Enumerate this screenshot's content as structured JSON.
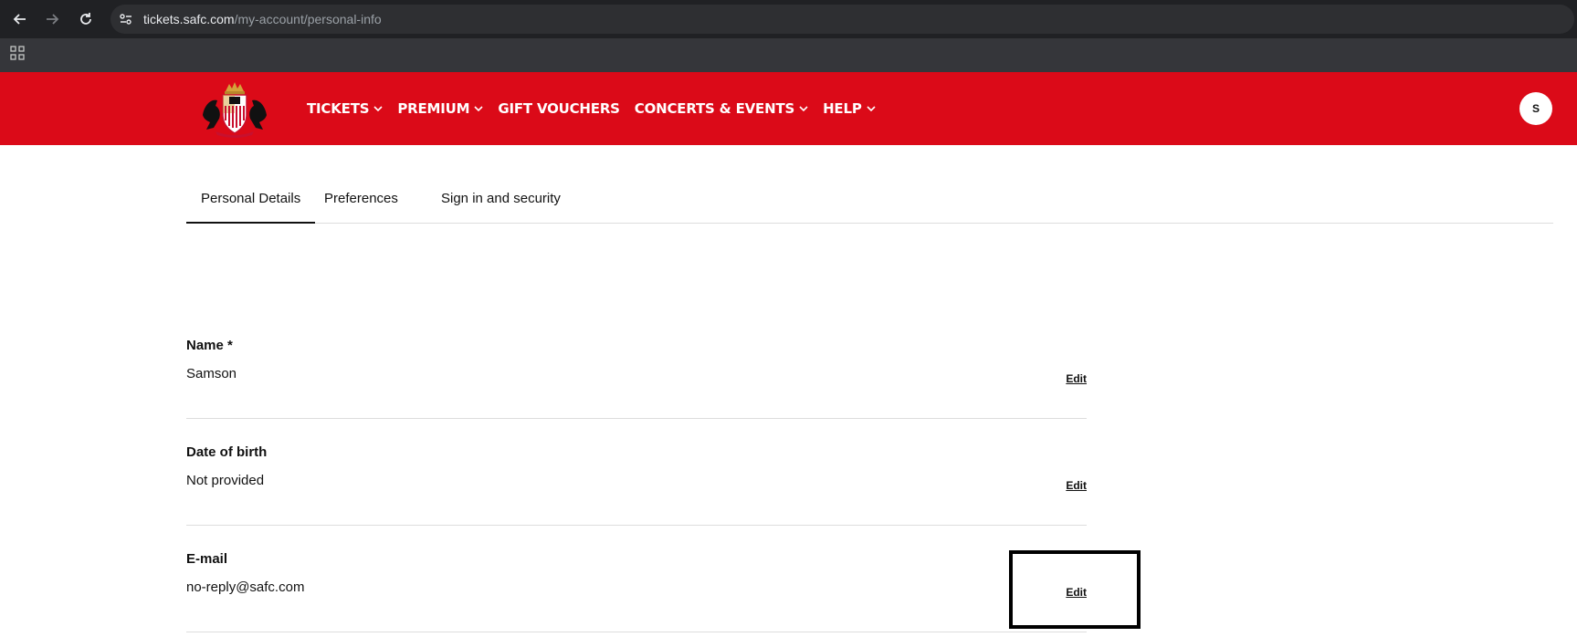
{
  "browser": {
    "url_host": "tickets.safc.com",
    "url_path": "/my-account/personal-info"
  },
  "header": {
    "nav": [
      {
        "label": "TICKETS",
        "dropdown": true
      },
      {
        "label": "PREMIUM",
        "dropdown": true
      },
      {
        "label": "GIFT VOUCHERS",
        "dropdown": false
      },
      {
        "label": "CONCERTS & EVENTS",
        "dropdown": true
      },
      {
        "label": "HELP",
        "dropdown": true
      }
    ],
    "avatar_initial": "S",
    "brand_color": "#db0a18"
  },
  "tabs": [
    {
      "label": "Personal Details",
      "active": true
    },
    {
      "label": "Preferences",
      "active": false
    },
    {
      "label": "Sign in and security",
      "active": false
    }
  ],
  "fields": [
    {
      "label": "Name *",
      "value": "Samson",
      "edit_label": "Edit"
    },
    {
      "label": "Date of birth",
      "value": "Not provided",
      "edit_label": "Edit"
    },
    {
      "label": "E-mail",
      "value": "no-reply@safc.com",
      "edit_label": "Edit"
    }
  ]
}
